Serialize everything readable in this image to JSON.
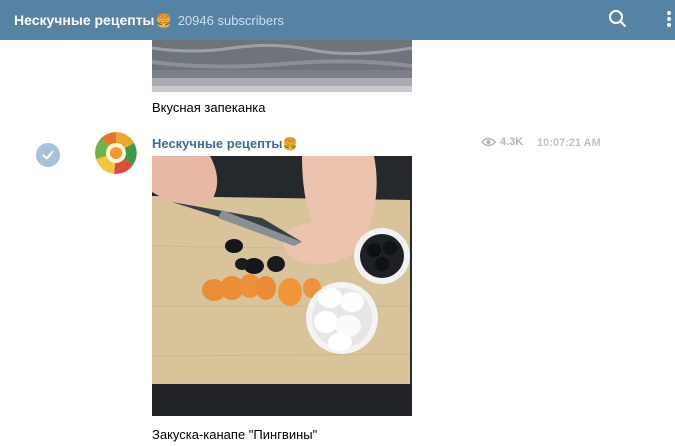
{
  "header": {
    "channel_name": "Нескучные рецепты",
    "channel_emoji": "🍔",
    "subscribers": "20946 subscribers",
    "search_icon": "search-icon",
    "menu_icon": "more-vertical-icon"
  },
  "messages": [
    {
      "caption": "Вкусная запеканка"
    },
    {
      "author": "Нескучные рецепты",
      "author_emoji": "🍔",
      "views": "4.3K",
      "time": "10:07:21 AM",
      "caption": "Закуска-канапе \"Пингвины\""
    }
  ],
  "colors": {
    "header_bg": "#5682a3",
    "author": "#3a6d99",
    "check_bg": "#a7c2d7"
  }
}
